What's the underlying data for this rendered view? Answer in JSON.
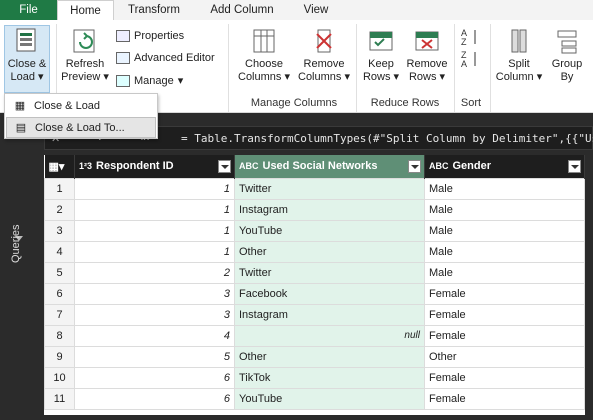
{
  "tabs": [
    "File",
    "Home",
    "Transform",
    "Add Column",
    "View"
  ],
  "ribbon": {
    "close_load": "Close &",
    "close_load2": "Load",
    "refresh": "Refresh",
    "refresh2": "Preview",
    "properties": "Properties",
    "advanced_editor": "Advanced Editor",
    "manage": "Manage",
    "choose": "Choose",
    "choose2": "Columns",
    "remove": "Remove",
    "remove2": "Columns",
    "keep": "Keep",
    "keep2": "Rows",
    "remove_rows": "Remove",
    "remove_rows2": "Rows",
    "split": "Split",
    "split2": "Column",
    "group": "Group",
    "group2": "By",
    "group_manage_columns": "Manage Columns",
    "group_reduce_rows": "Reduce Rows",
    "group_sort": "Sort"
  },
  "dropdown": {
    "items": [
      "Close & Load",
      "Close & Load To..."
    ]
  },
  "queries_label": "Queries",
  "formula": {
    "text": "= Table.TransformColumnTypes(#\"Split Column by Delimiter\",{{\"Used"
  },
  "table": {
    "headers": [
      {
        "type": "1²3",
        "name": "Respondent ID"
      },
      {
        "type": "ABC",
        "name": "Used Social Networks"
      },
      {
        "type": "ABC",
        "name": "Gender"
      }
    ],
    "rows": [
      [
        "1",
        "1",
        "Twitter",
        "Male"
      ],
      [
        "2",
        "1",
        "Instagram",
        "Male"
      ],
      [
        "3",
        "1",
        "YouTube",
        "Male"
      ],
      [
        "4",
        "1",
        "Other",
        "Male"
      ],
      [
        "5",
        "2",
        "Twitter",
        "Male"
      ],
      [
        "6",
        "3",
        "Facebook",
        "Female"
      ],
      [
        "7",
        "3",
        "Instagram",
        "Female"
      ],
      [
        "8",
        "4",
        "null",
        "Female"
      ],
      [
        "9",
        "5",
        "Other",
        "Other"
      ],
      [
        "10",
        "6",
        "TikTok",
        "Female"
      ],
      [
        "11",
        "6",
        "YouTube",
        "Female"
      ]
    ]
  }
}
